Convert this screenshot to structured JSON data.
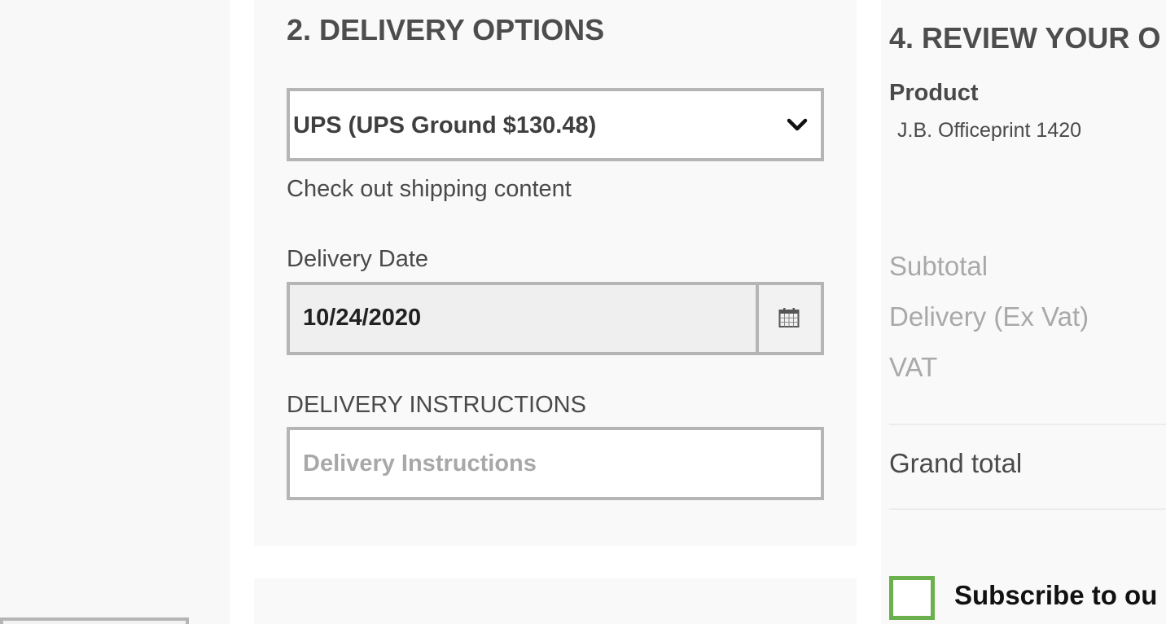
{
  "delivery": {
    "title": "2. DELIVERY OPTIONS",
    "shipping_method": "UPS (UPS Ground $130.48)",
    "help_link": "Check out shipping content",
    "date_label": "Delivery Date",
    "date_value": "10/24/2020",
    "instructions_label": "DELIVERY INSTRUCTIONS",
    "instructions_placeholder": "Delivery Instructions",
    "instructions_value": ""
  },
  "review": {
    "title": "4. REVIEW YOUR O",
    "product_label": "Product",
    "product_name": "J.B. Officeprint 1420",
    "subtotal_label": "Subtotal",
    "delivery_label": "Delivery (Ex Vat)",
    "vat_label": "VAT",
    "grand_total_label": "Grand total",
    "subscribe_label": "Subscribe to ou"
  },
  "icons": {
    "dropdown": "chevron-down-icon",
    "calendar": "calendar-icon"
  },
  "colors": {
    "checkbox_border": "#6ab04c",
    "field_border": "#b5b5b5",
    "panel_background": "#f9f9f9",
    "muted_text": "#a9a9a9"
  }
}
